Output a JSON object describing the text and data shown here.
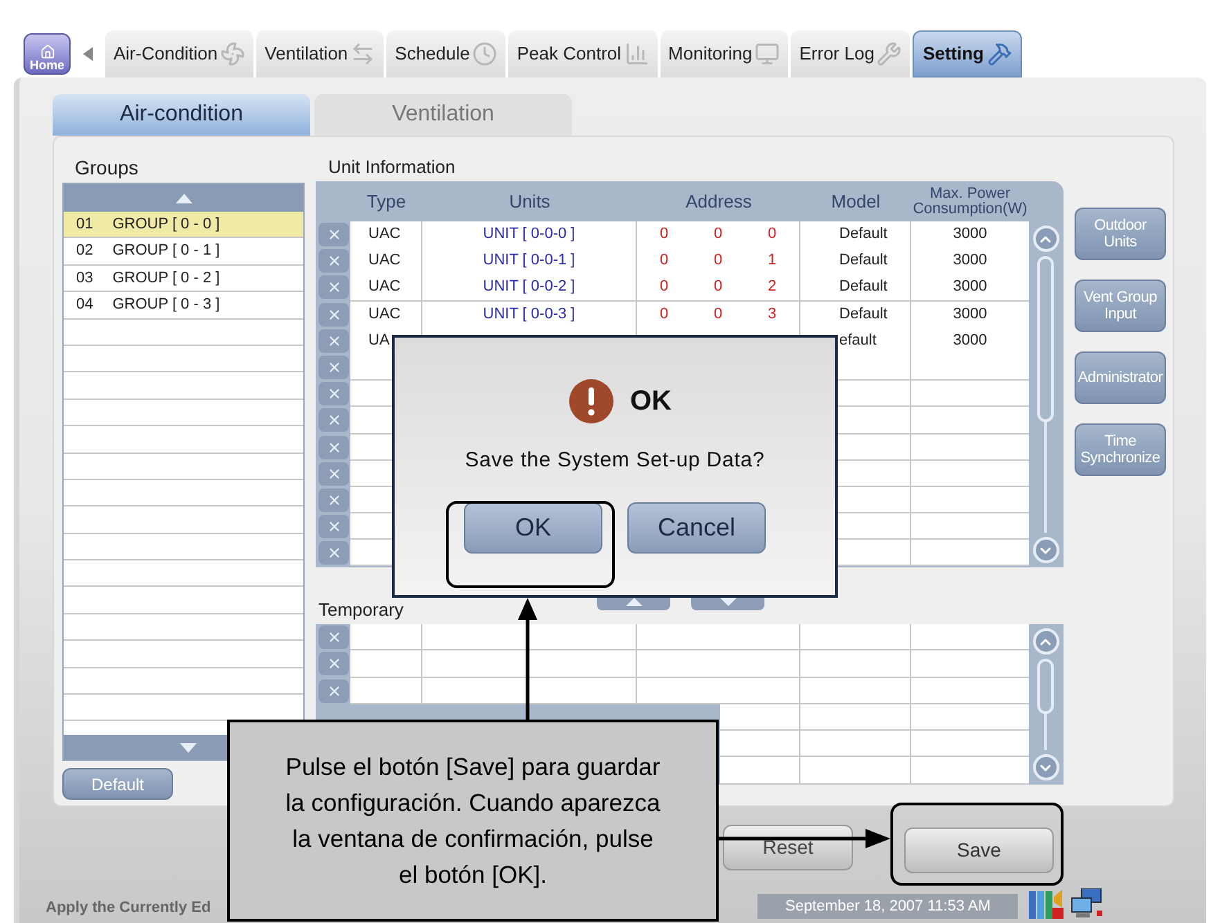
{
  "nav": {
    "home": "Home",
    "tabs": [
      {
        "label": "Air-Condition",
        "kind": "fan",
        "selected": false
      },
      {
        "label": "Ventilation",
        "kind": "arrows",
        "selected": false
      },
      {
        "label": "Schedule",
        "kind": "clock",
        "selected": false
      },
      {
        "label": "Peak Control",
        "kind": "chart",
        "selected": false
      },
      {
        "label": "Monitoring",
        "kind": "monitor",
        "selected": false
      },
      {
        "label": "Error Log",
        "kind": "wrench",
        "selected": false
      },
      {
        "label": "Setting",
        "kind": "tools",
        "selected": true
      }
    ]
  },
  "subtabs": [
    {
      "label": "Air-condition",
      "selected": true
    },
    {
      "label": "Ventilation",
      "selected": false
    }
  ],
  "groups": {
    "title": "Groups",
    "items": [
      {
        "number": "01",
        "name": "GROUP [ 0 - 0 ]",
        "selected": true
      },
      {
        "number": "02",
        "name": "GROUP [ 0 - 1 ]",
        "selected": false
      },
      {
        "number": "03",
        "name": "GROUP [ 0 - 2 ]",
        "selected": false
      },
      {
        "number": "04",
        "name": "GROUP [ 0 - 3 ]",
        "selected": false
      }
    ],
    "default_button": "Default"
  },
  "unit_information": {
    "title": "Unit Information",
    "columns": [
      "Type",
      "Units",
      "Address",
      "Model",
      "Max. Power Consumption(W)"
    ],
    "rows": [
      {
        "type": "UAC",
        "unit": "UNIT [ 0-0-0 ]",
        "address": [
          "0",
          "0",
          "0"
        ],
        "model": "Default",
        "max_power": "3000"
      },
      {
        "type": "UAC",
        "unit": "UNIT [ 0-0-1 ]",
        "address": [
          "0",
          "0",
          "1"
        ],
        "model": "Default",
        "max_power": "3000"
      },
      {
        "type": "UAC",
        "unit": "UNIT [ 0-0-2 ]",
        "address": [
          "0",
          "0",
          "2"
        ],
        "model": "Default",
        "max_power": "3000"
      },
      {
        "type": "UAC",
        "unit": "UNIT [ 0-0-3 ]",
        "address": [
          "0",
          "0",
          "3"
        ],
        "model": "Default",
        "max_power": "3000"
      },
      {
        "type": "UA",
        "model": "efault",
        "max_power": "3000"
      }
    ]
  },
  "side_buttons": [
    "Outdoor Units",
    "Vent Group Input",
    "Administrator",
    "Time Synchronize"
  ],
  "temporary": {
    "title": "Temporary"
  },
  "buttons": {
    "reset": "Reset",
    "save": "Save"
  },
  "status_bar": {
    "message": "Apply the Currently Ed",
    "datetime": "September 18, 2007 11:53 AM"
  },
  "dialog": {
    "title": "OK",
    "message": "Save the System Set-up Data?",
    "buttons": [
      "OK",
      "Cancel"
    ]
  },
  "callout": {
    "text": "Pulse el botón [Save] para guardar la configuración. Cuando aparezca la ventana de confirmación, pulse el botón [OK]."
  }
}
